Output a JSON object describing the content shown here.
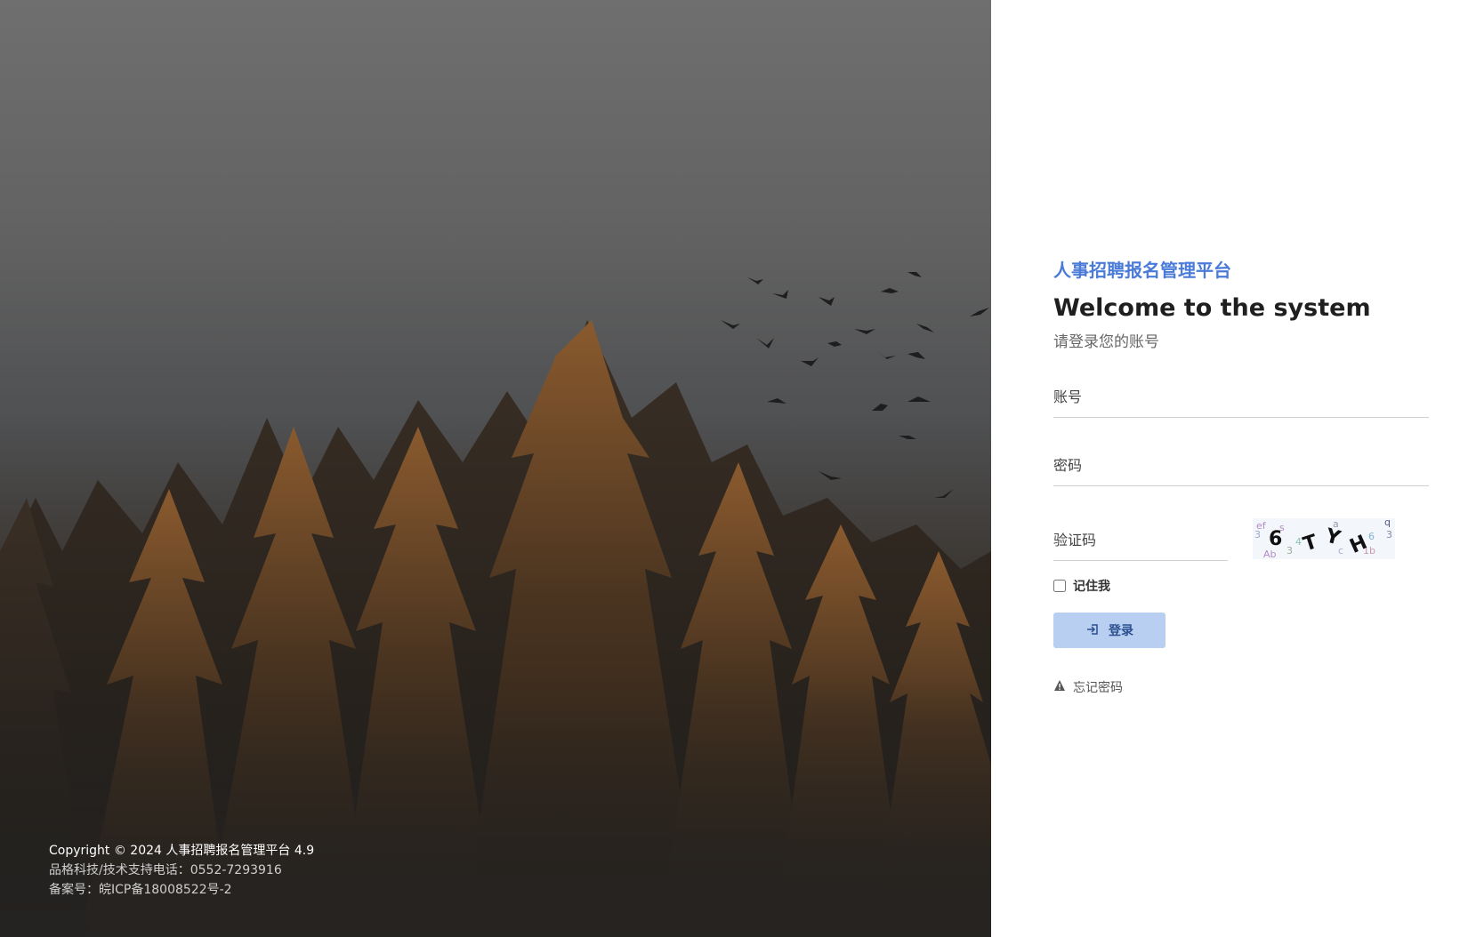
{
  "brand": {
    "platform_name": "人事招聘报名管理平台",
    "welcome": "Welcome to the system",
    "subtitle": "请登录您的账号"
  },
  "form": {
    "account_placeholder": "账号",
    "password_placeholder": "密码",
    "captcha_placeholder": "验证码",
    "captcha_text": "6TYH",
    "remember_label": "记住我",
    "remember_checked": false,
    "login_label": "登录",
    "forgot_label": "忘记密码"
  },
  "footer": {
    "copyright": "Copyright © 2024 人事招聘报名管理平台 4.9",
    "support": "品格科技/技术支持电话：0552-7293916",
    "icp": "备案号：皖ICP备18008522号-2"
  },
  "icons": {
    "login": "login-icon",
    "warning": "warning-icon"
  },
  "colors": {
    "accent": "#4a7bd8",
    "button_bg": "#b9cff2"
  }
}
